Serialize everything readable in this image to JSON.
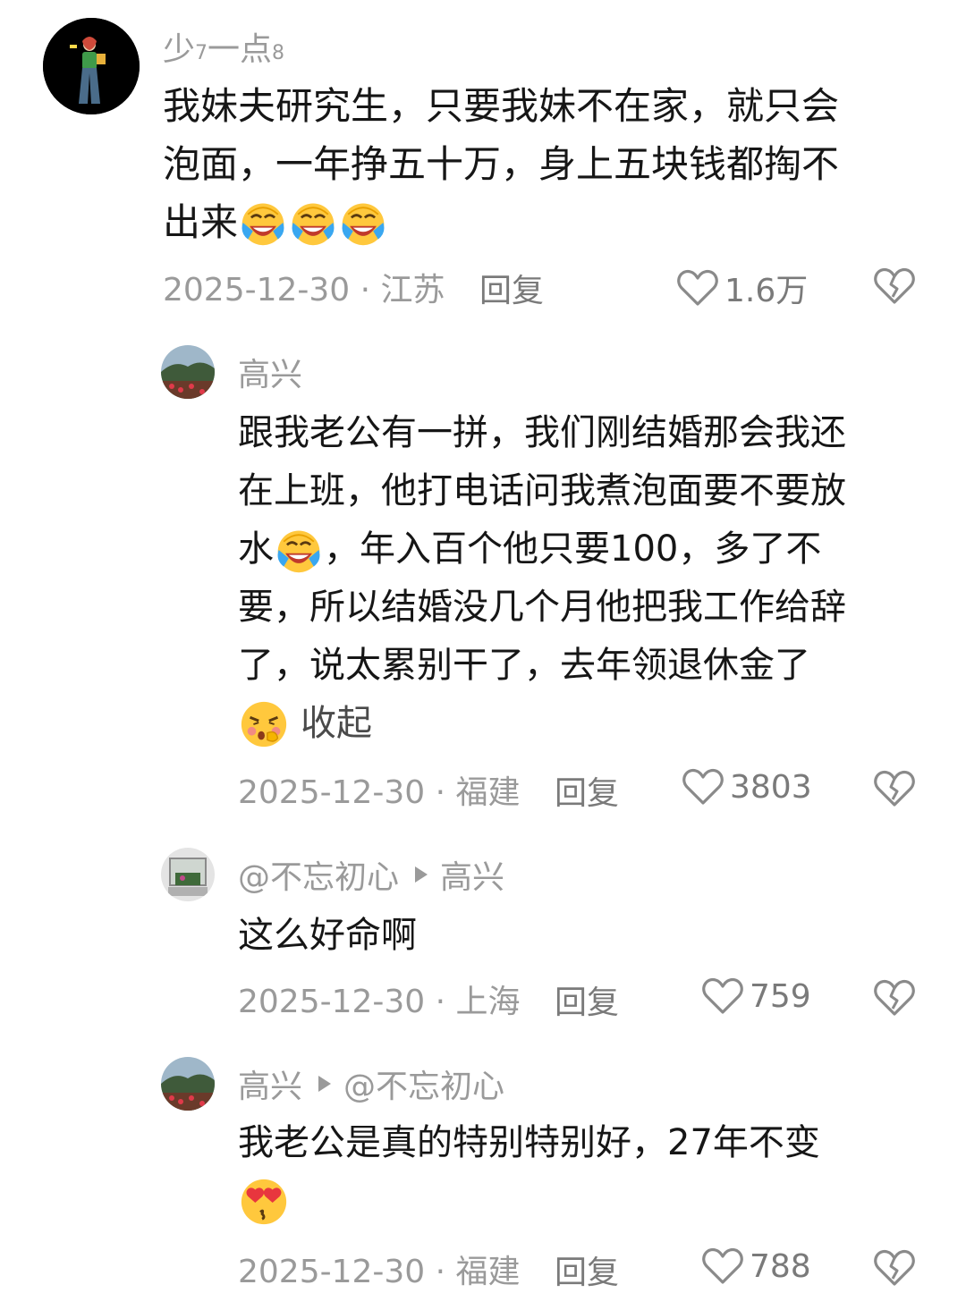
{
  "comments": [
    {
      "username_main": "少",
      "username_sub1": "7",
      "username_mid": "一点",
      "username_sub2": "8",
      "text_lines": [
        "我妹夫研究生，只要我妹不在家，就只会",
        "泡面，一年挣五十万，身上五块钱都掏不",
        "出来"
      ],
      "date_region": "2025-12-30 · 江苏",
      "reply_label": "回复",
      "likes": "1.6万"
    },
    {
      "username": "高兴",
      "text_lines": [
        "跟我老公有一拼，我们刚结婚那会我还",
        "在上班，他打电话问我煮泡面要不要放",
        "水",
        "，年入百个他只要100，多了不",
        "要，所以结婚没几个月他把我工作给辞",
        "了，说太累别干了，去年领退休金了"
      ],
      "collapse_label": "收起",
      "date_region": "2025-12-30 · 福建",
      "reply_label": "回复",
      "likes": "3803"
    },
    {
      "username": "@不忘初心",
      "reply_to": "高兴",
      "text": "这么好命啊",
      "date_region": "2025-12-30 · 上海",
      "reply_label": "回复",
      "likes": "759"
    },
    {
      "username": "高兴",
      "reply_to": "@不忘初心",
      "text": "我老公是真的特别特别好，27年不变",
      "date_region": "2025-12-30 · 福建",
      "reply_label": "回复",
      "likes": "788"
    }
  ],
  "icons": {
    "like": "heart-outline-icon",
    "dislike": "broken-heart-icon",
    "laugh_cry": "rolling-laughing-emoji",
    "shy": "blushing-shy-emoji",
    "love": "heart-eyes-emoji"
  },
  "colors": {
    "username": "#9a9a9a",
    "text": "#161616",
    "meta": "#9a9a9a"
  }
}
